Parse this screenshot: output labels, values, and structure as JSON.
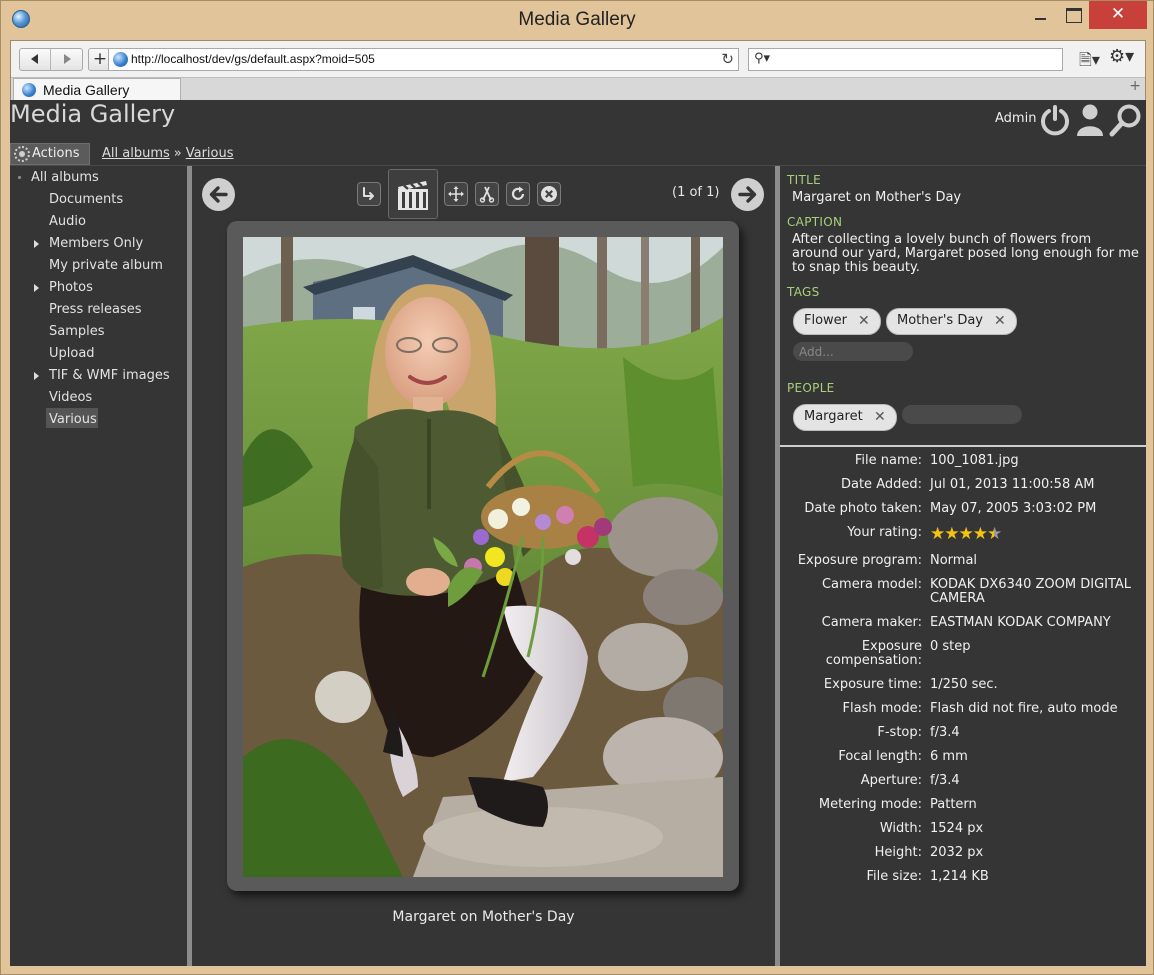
{
  "window": {
    "title": "Media Gallery"
  },
  "browser": {
    "url": "http://localhost/dev/gs/default.aspx?moid=505",
    "search_placeholder": "",
    "tab_label": "Media Gallery"
  },
  "header": {
    "site_title": "Media Gallery",
    "user_name": "Admin",
    "actions_label": "Actions",
    "breadcrumb": [
      {
        "label": "All albums"
      },
      {
        "label": "Various"
      }
    ],
    "breadcrumb_separator": "»"
  },
  "tree": {
    "root": "All albums",
    "items": [
      {
        "label": "Documents",
        "has_children": false
      },
      {
        "label": "Audio",
        "has_children": false
      },
      {
        "label": "Members Only",
        "has_children": true
      },
      {
        "label": "My private album",
        "has_children": false
      },
      {
        "label": "Photos",
        "has_children": true
      },
      {
        "label": "Press releases",
        "has_children": false
      },
      {
        "label": "Samples",
        "has_children": false
      },
      {
        "label": "Upload",
        "has_children": false
      },
      {
        "label": "TIF & WMF images",
        "has_children": true
      },
      {
        "label": "Videos",
        "has_children": false
      },
      {
        "label": "Various",
        "has_children": false,
        "selected": true
      }
    ]
  },
  "viewer": {
    "position": "(1 of 1)",
    "caption": "Margaret on Mother's Day",
    "toolbar_icons": [
      "share-icon",
      "slideshow-icon",
      "move-icon",
      "crop-icon",
      "rotate-icon",
      "delete-icon"
    ]
  },
  "meta": {
    "title_label": "TITLE",
    "title": "Margaret on Mother's Day",
    "caption_label": "CAPTION",
    "caption": "After collecting a lovely bunch of flowers from around our yard, Margaret posed long enough for me to snap this beauty.",
    "tags_label": "TAGS",
    "tags": [
      "Flower",
      "Mother's Day"
    ],
    "tag_placeholder": "Add...",
    "people_label": "PEOPLE",
    "people": [
      "Margaret"
    ],
    "remove_glyph": "✕",
    "rating": 4.5,
    "rating_max": 5,
    "fields": [
      {
        "label": "File name:",
        "value": "100_1081.jpg"
      },
      {
        "label": "Date Added:",
        "value": "Jul 01, 2013 11:00:58 AM"
      },
      {
        "label": "Date photo taken:",
        "value": "May 07, 2005 3:03:02 PM"
      },
      {
        "label": "Your rating:",
        "value": ""
      },
      {
        "label": "Exposure program:",
        "value": "Normal"
      },
      {
        "label": "Camera model:",
        "value": "KODAK DX6340 ZOOM DIGITAL CAMERA"
      },
      {
        "label": "Camera maker:",
        "value": "EASTMAN KODAK COMPANY"
      },
      {
        "label": "Exposure compensation:",
        "value": "0 step"
      },
      {
        "label": "Exposure time:",
        "value": "1/250 sec."
      },
      {
        "label": "Flash mode:",
        "value": "Flash did not fire, auto mode"
      },
      {
        "label": "F-stop:",
        "value": "f/3.4"
      },
      {
        "label": "Focal length:",
        "value": "6 mm"
      },
      {
        "label": "Aperture:",
        "value": "f/3.4"
      },
      {
        "label": "Metering mode:",
        "value": "Pattern"
      },
      {
        "label": "Width:",
        "value": "1524 px"
      },
      {
        "label": "Height:",
        "value": "2032 px"
      },
      {
        "label": "File size:",
        "value": "1,214 KB"
      }
    ]
  },
  "colors": {
    "page_bg": "#353535",
    "section_label": "#a8d07c",
    "star": "#f2c313",
    "close_button": "#c7413a",
    "window_frame": "#e2c49a"
  }
}
